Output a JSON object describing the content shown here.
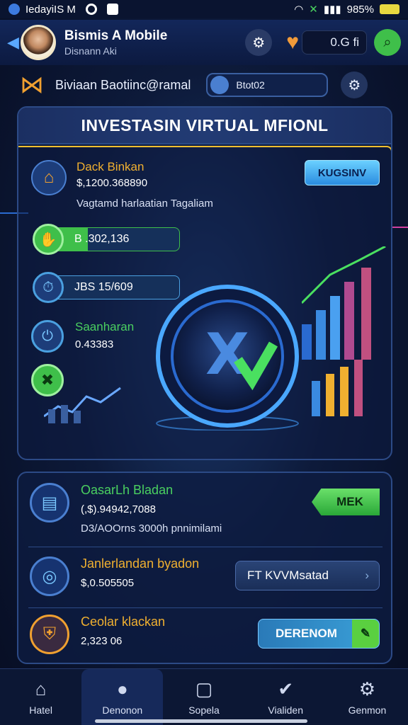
{
  "status": {
    "left": "IedayiIS M",
    "battery_pct": "985%"
  },
  "header": {
    "user_name": "Bismis A Mobile",
    "user_sub": "Disnann Aki",
    "balance": "0.G fi"
  },
  "profile": {
    "text": "Biviaan Baotiinc@ramal",
    "pill_text": "Btot02"
  },
  "card": {
    "title": "INVESTASIN VIRTUAL MFIONL",
    "item": {
      "title": "Dack Binkan",
      "value": "$,1200.368890",
      "desc": "Vagtamd harlaatian Tagaliam"
    },
    "cta_label": "KUGSINV",
    "stat1": "B   .302,136",
    "stat2": "JBS 15/609",
    "stat3": {
      "title": "Saanharan",
      "value": "0.43383"
    },
    "coin_label": "X"
  },
  "list": {
    "item1": {
      "title": "OasarLh Bladan",
      "value": "(,$).94942,7088",
      "desc": "D3/AOOrns 3000h pnnimilami",
      "button": "MEK"
    },
    "item2": {
      "title": "Janlerlandan byadon",
      "value": "$,0.505505",
      "button": "FT KVVMsatad"
    },
    "item3": {
      "title": "Ceolar klackan",
      "value": "2,323 06",
      "button": "DERENOM"
    }
  },
  "nav": {
    "tabs": [
      "Hatel",
      "Denonon",
      "Sopela",
      "Vialiden",
      "Genmon"
    ],
    "active_index": 1
  },
  "colors": {
    "accent_green": "#3fbf4a",
    "accent_gold": "#f0b030",
    "accent_blue": "#2a8ce0"
  }
}
